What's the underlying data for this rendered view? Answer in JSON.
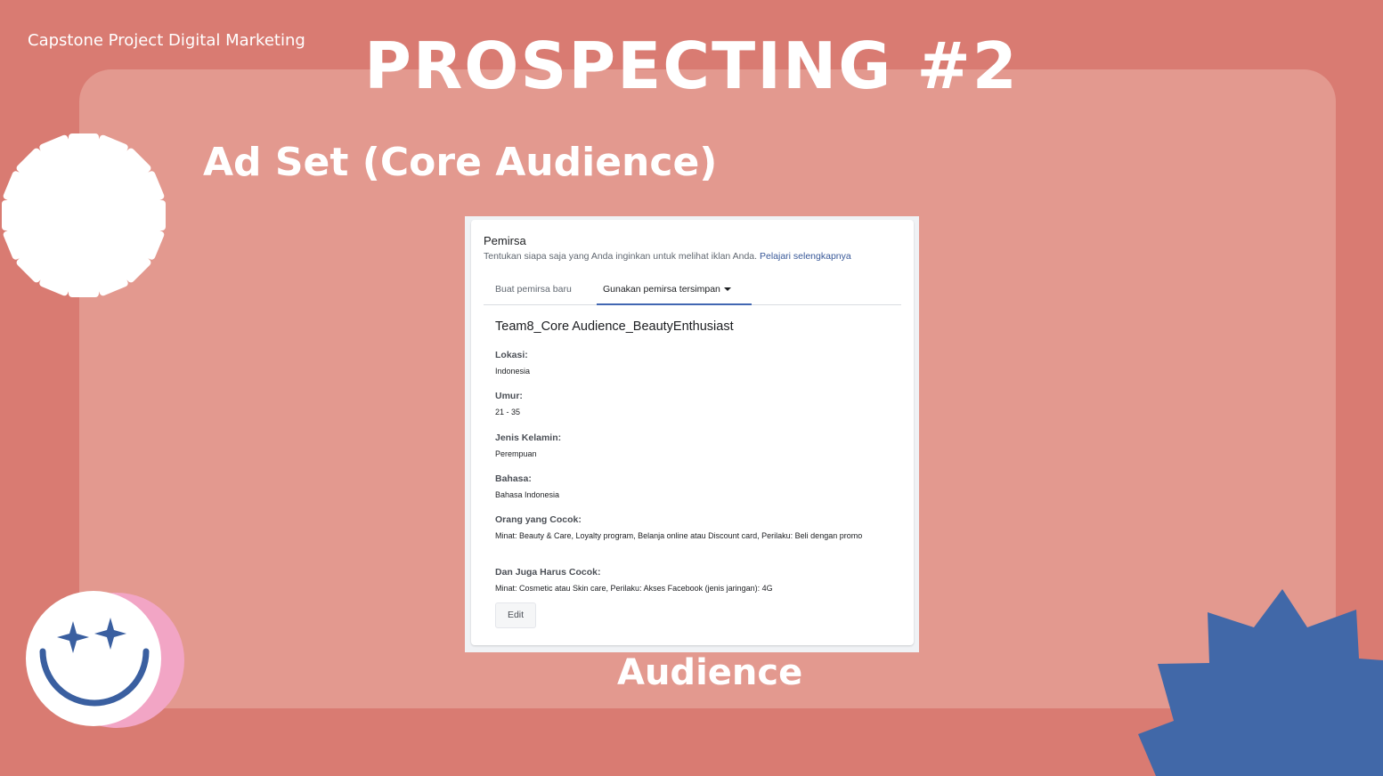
{
  "slide": {
    "project_label": "Capstone Project Digital Marketing",
    "title": "PROSPECTING #2",
    "subtitle": "Ad Set (Core Audience)",
    "caption": "Audience"
  },
  "audience_panel": {
    "title": "Pemirsa",
    "description": "Tentukan siapa saja yang Anda inginkan untuk melihat iklan Anda.",
    "learn_more_link": "Pelajari selengkapnya",
    "tabs": [
      {
        "label": "Buat pemirsa baru",
        "active": false
      },
      {
        "label": "Gunakan pemirsa tersimpan",
        "active": true
      }
    ],
    "audience_name": "Team8_Core Audience_BeautyEnthusiast",
    "fields": [
      {
        "label": "Lokasi:",
        "value": "Indonesia"
      },
      {
        "label": "Umur:",
        "value": "21 - 35"
      },
      {
        "label": "Jenis Kelamin:",
        "value": "Perempuan"
      },
      {
        "label": "Bahasa:",
        "value": "Bahasa Indonesia"
      },
      {
        "label": "Orang yang Cocok:",
        "value": "Minat: Beauty & Care, Loyalty program, Belanja online atau Discount card, Perilaku: Beli dengan promo"
      },
      {
        "label": "Dan Juga Harus Cocok:",
        "value": "Minat: Cosmetic atau Skin care, Perilaku: Akses Facebook (jenis jaringan): 4G"
      }
    ],
    "edit_button": "Edit"
  },
  "colors": {
    "background": "#d97b72",
    "panel": "#e3998f",
    "accent_blue": "#4267b2",
    "smiley_blue": "#3a5fa0",
    "pink": "#f2a5c5"
  },
  "icons": [
    "asterisk-flower-icon",
    "smiley-face-icon",
    "starburst-icon",
    "dropdown-caret-icon"
  ]
}
